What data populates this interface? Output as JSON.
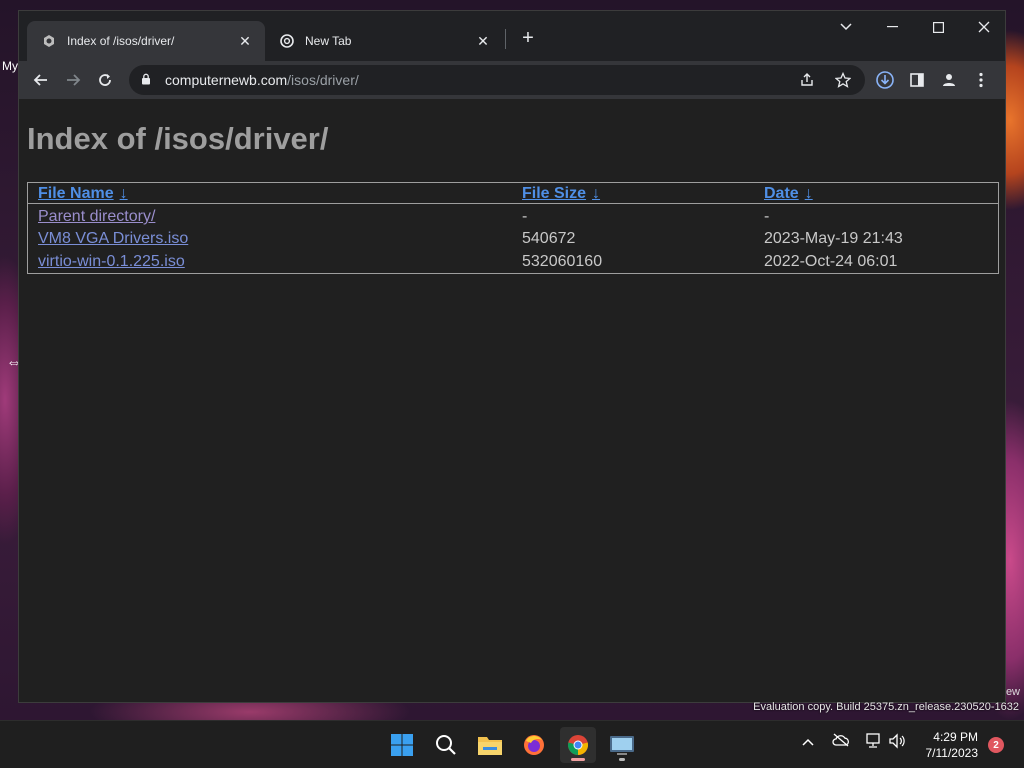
{
  "desktop": {
    "left_text": "My",
    "right_text": "ew",
    "watermark": "Evaluation copy. Build 25375.zn_release.230520-1632"
  },
  "browser": {
    "tabs": [
      {
        "title": "Index of /isos/driver/",
        "active": true
      },
      {
        "title": "New Tab",
        "active": false
      }
    ],
    "url_host": "computernewb.com",
    "url_path": "/isos/driver/"
  },
  "page": {
    "heading": "Index of /isos/driver/",
    "columns": {
      "name": "File Name",
      "size": "File Size",
      "date": "Date",
      "sort_arrow": "↓"
    },
    "rows": [
      {
        "name": "Parent directory/",
        "size": "-",
        "date": "-"
      },
      {
        "name": "VM8 VGA Drivers.iso",
        "size": "540672",
        "date": "2023-May-19 21:43"
      },
      {
        "name": "virtio-win-0.1.225.iso",
        "size": "532060160",
        "date": "2022-Oct-24 06:01"
      }
    ]
  },
  "taskbar": {
    "time": "4:29 PM",
    "date": "7/11/2023",
    "notification_count": "2"
  },
  "colors": {
    "link": "#4f8fe6",
    "page_bg": "#202020",
    "heading": "#9e9e9e"
  }
}
